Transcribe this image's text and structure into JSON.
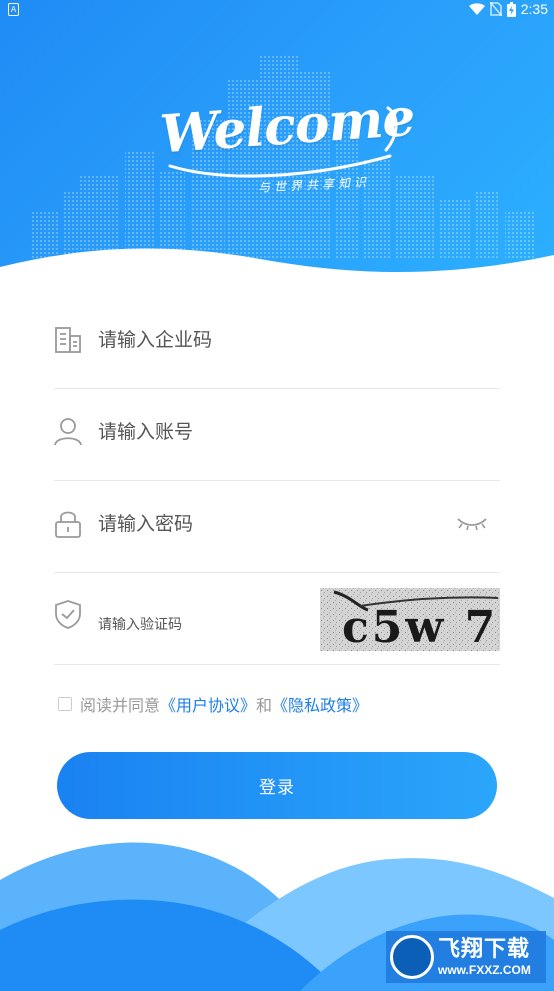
{
  "status_bar": {
    "app_icon_letter": "A",
    "time": "2:35",
    "icons": [
      "wifi-icon",
      "no-sim-icon",
      "battery-charging-icon"
    ]
  },
  "header": {
    "welcome_title": "Welcome",
    "welcome_subtitle": "与世界共享知识"
  },
  "form": {
    "company_code_placeholder": "请输入企业码",
    "account_placeholder": "请输入账号",
    "password_placeholder": "请输入密码",
    "captcha_placeholder": "请输入验证码",
    "captcha_text": "c5w 7"
  },
  "agreement": {
    "prefix": "阅读并同意",
    "user_agreement": "《用户协议》",
    "conjunction": "和",
    "privacy_policy": "《隐私政策》",
    "checked": false
  },
  "login_button": "登录",
  "watermark": {
    "brand": "飞翔下载",
    "url": "www.FXXZ.COM"
  },
  "colors": {
    "primary": "#1f8bf5",
    "primary_light": "#2bb0ff",
    "link": "#1e7fe8",
    "placeholder": "#555555",
    "muted": "#999999",
    "divider": "#e8e8e8"
  }
}
